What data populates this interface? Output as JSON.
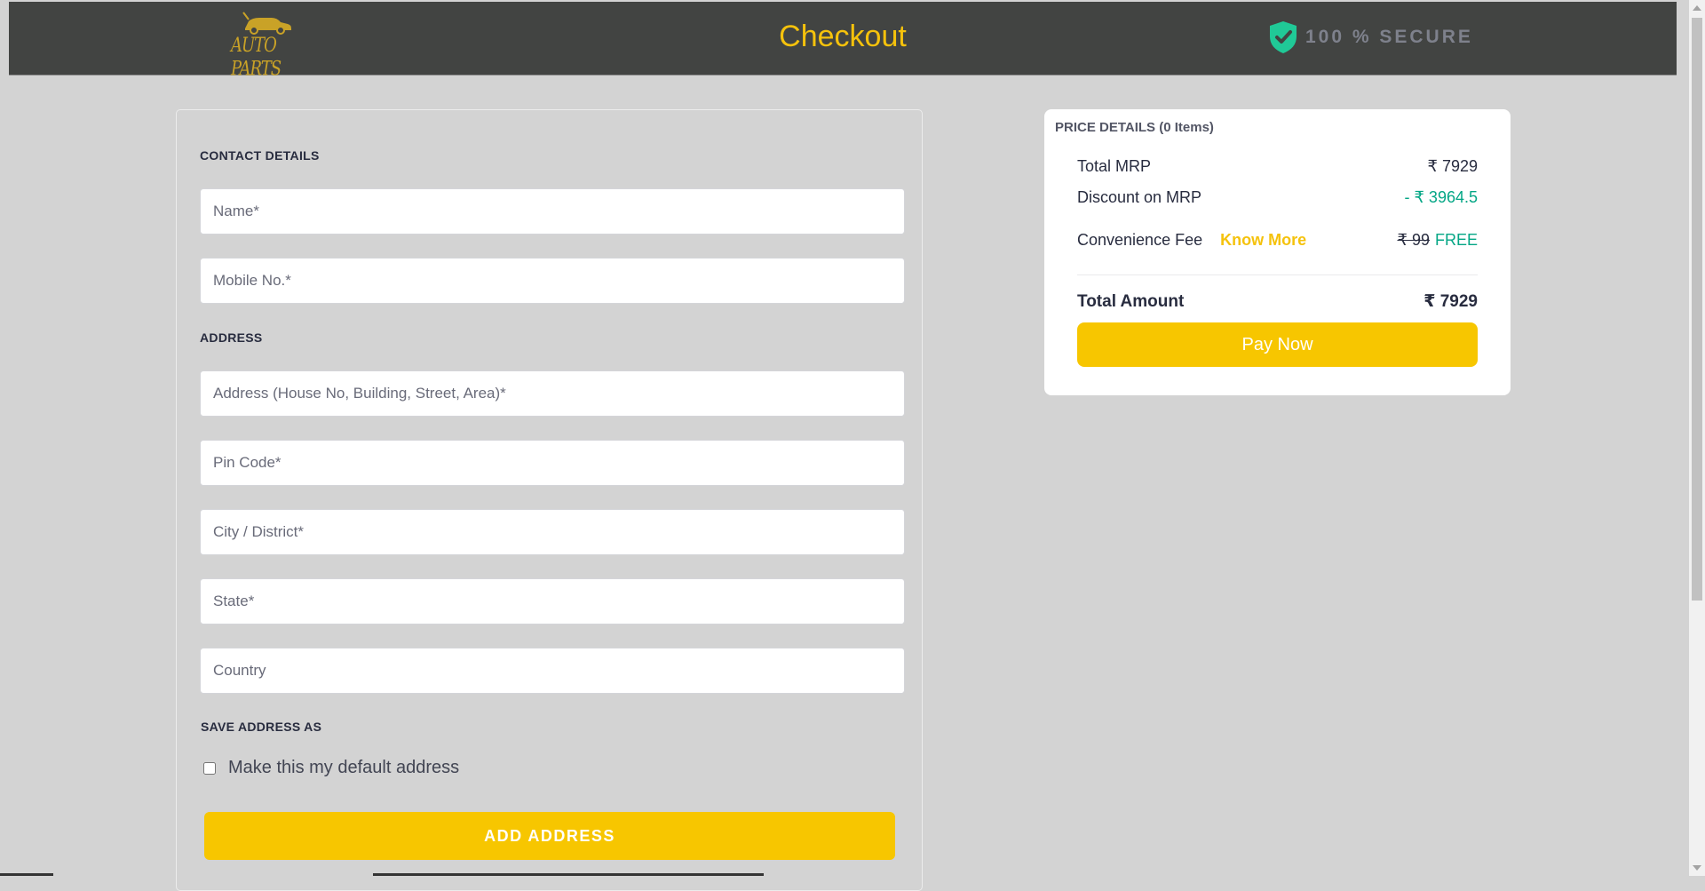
{
  "header": {
    "logo_text": "AUTO PARTS",
    "title": "Checkout",
    "secure_text": "100 % SECURE",
    "secure_icon": "shield-check-icon",
    "title_color": "#f5c20c"
  },
  "form": {
    "contact_label": "CONTACT DETAILS",
    "name_placeholder": "Name*",
    "mobile_placeholder": "Mobile No.*",
    "address_label": "ADDRESS",
    "address_placeholder": "Address (House No, Building, Street, Area)*",
    "pincode_placeholder": "Pin Code*",
    "city_placeholder": "City / District*",
    "state_placeholder": "State*",
    "country_placeholder": "Country",
    "save_as_label": "SAVE ADDRESS AS",
    "default_checkbox_label": "Make this my default address",
    "default_checked": false,
    "add_button": "ADD ADDRESS"
  },
  "price": {
    "header": "PRICE DETAILS (0 Items)",
    "total_mrp_label": "Total MRP",
    "total_mrp_value": "₹ 7929",
    "discount_label": "Discount on MRP",
    "discount_value": "- ₹ 3964.5",
    "fee_label": "Convenience Fee",
    "know_more": "Know More",
    "fee_original": "₹ 99",
    "fee_value": "FREE",
    "total_label": "Total Amount",
    "total_value": "₹ 7929",
    "pay_button": "Pay Now",
    "accent_color": "#f7c600",
    "discount_color": "#03a685"
  }
}
